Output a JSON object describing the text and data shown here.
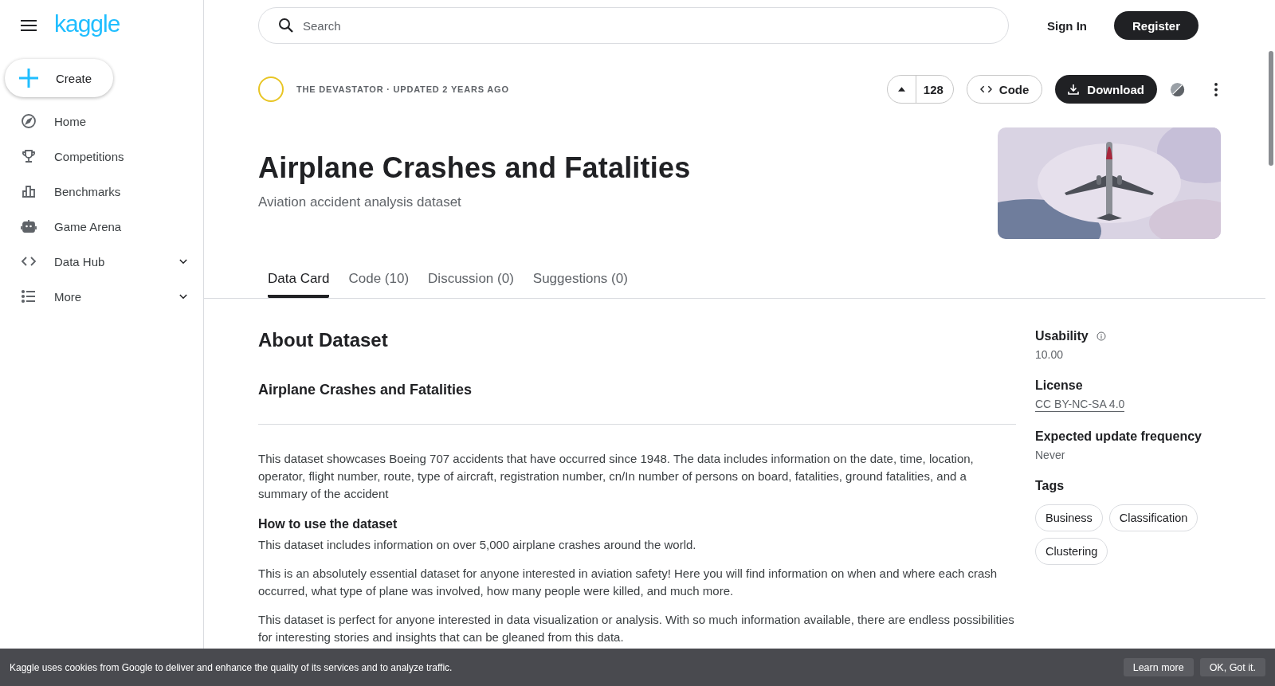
{
  "sidebar": {
    "logo": "kaggle",
    "create": "Create",
    "items": [
      {
        "label": "Home",
        "kind": "compass",
        "expandable": false
      },
      {
        "label": "Competitions",
        "kind": "trophy",
        "expandable": false
      },
      {
        "label": "Benchmarks",
        "kind": "bars",
        "expandable": false
      },
      {
        "label": "Game Arena",
        "kind": "robot",
        "expandable": false
      },
      {
        "label": "Data Hub",
        "kind": "code",
        "expandable": true
      },
      {
        "label": "More",
        "kind": "list",
        "expandable": true
      }
    ]
  },
  "header": {
    "search": {
      "placeholder": "Search"
    },
    "sign_in": "Sign In",
    "register": "Register"
  },
  "dataset": {
    "meta": "THE DEVASTATOR · UPDATED 2 YEARS AGO",
    "votes": "128",
    "code": "Code",
    "download": "Download",
    "title": "Airplane Crashes and Fatalities",
    "subtitle": "Aviation accident analysis dataset"
  },
  "tabs": [
    {
      "label": "Data Card",
      "selected": true
    },
    {
      "label": "Code (10)",
      "selected": false
    },
    {
      "label": "Discussion (0)",
      "selected": false
    },
    {
      "label": "Suggestions (0)",
      "selected": false
    }
  ],
  "about": {
    "heading": "About Dataset",
    "subheading": "Airplane Crashes and Fatalities",
    "blocks": [
      {
        "kind": "paragraph",
        "text": "This dataset showcases Boeing 707 accidents that have occurred since 1948. The data includes information on the date, time, location, operator, flight number, route, type of aircraft, registration number, cn/In number of persons on board, fatalities, ground fatalities, and a summary of the accident"
      },
      {
        "kind": "heading",
        "text": "How to use the dataset"
      },
      {
        "kind": "paragraph",
        "text": "This dataset includes information on over 5,000 airplane crashes around the world."
      },
      {
        "kind": "paragraph",
        "text": "This is an absolutely essential dataset for anyone interested in aviation safety! Here you will find information on when and where each crash occurred, what type of plane was involved, how many people were killed, and much more."
      },
      {
        "kind": "paragraph",
        "text": "This dataset is perfect for anyone interested in data visualization or analysis. With so much information available, there are endless possibilities for interesting stories and insights that can be gleaned from this data."
      }
    ]
  },
  "details": {
    "usability": {
      "label": "Usability",
      "value": "10.00"
    },
    "license": {
      "label": "License",
      "value": "CC BY-NC-SA 4.0"
    },
    "frequency": {
      "label": "Expected update frequency",
      "value": "Never"
    },
    "tags_label": "Tags",
    "tags": [
      "Business",
      "Classification",
      "Clustering"
    ]
  },
  "cookie_bar": {
    "text": "Kaggle uses cookies from Google to deliver and enhance the quality of its services and to analyze traffic.",
    "learn_more": "Learn more",
    "ok": "OK, Got it."
  }
}
